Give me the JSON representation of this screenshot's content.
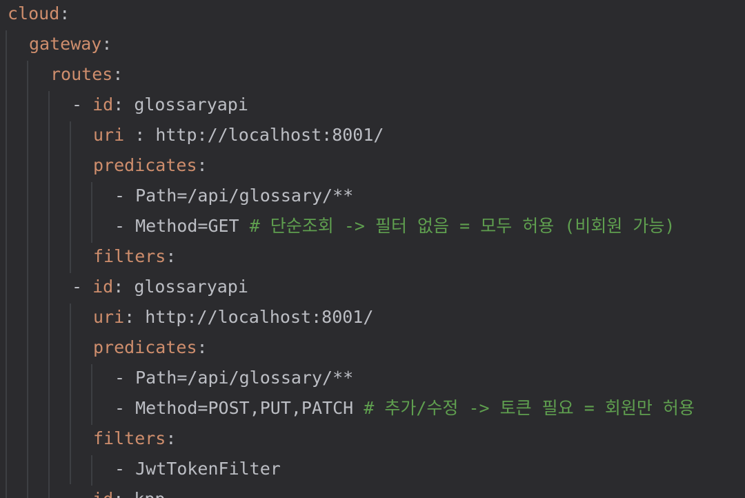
{
  "lines": [
    {
      "indent": 0,
      "key": "cloud",
      "sep": ":",
      "value": "",
      "comment": ""
    },
    {
      "indent": 1,
      "key": "gateway",
      "sep": ":",
      "value": "",
      "comment": ""
    },
    {
      "indent": 2,
      "key": "routes",
      "sep": ":",
      "value": "",
      "comment": ""
    },
    {
      "indent": 3,
      "dash": "- ",
      "key": "id",
      "sep": ":",
      "value": " glossaryapi",
      "comment": ""
    },
    {
      "indent": 4,
      "key": "uri",
      "sep": " :",
      "value": " http://localhost:8001/",
      "comment": ""
    },
    {
      "indent": 4,
      "key": "predicates",
      "sep": ":",
      "value": "",
      "comment": ""
    },
    {
      "indent": 5,
      "dash": "- ",
      "key": "",
      "sep": "",
      "value": "Path=/api/glossary/**",
      "comment": ""
    },
    {
      "indent": 5,
      "dash": "- ",
      "key": "",
      "sep": "",
      "value": "Method=GET ",
      "comment": "# 단순조회 -> 필터 없음 = 모두 허용 (비회원 가능)"
    },
    {
      "indent": 4,
      "key": "filters",
      "sep": ":",
      "value": "",
      "comment": ""
    },
    {
      "indent": 3,
      "dash": "- ",
      "key": "id",
      "sep": ":",
      "value": " glossaryapi",
      "comment": ""
    },
    {
      "indent": 4,
      "key": "uri",
      "sep": ":",
      "value": " http://localhost:8001/",
      "comment": ""
    },
    {
      "indent": 4,
      "key": "predicates",
      "sep": ":",
      "value": "",
      "comment": ""
    },
    {
      "indent": 5,
      "dash": "- ",
      "key": "",
      "sep": "",
      "value": "Path=/api/glossary/**",
      "comment": ""
    },
    {
      "indent": 5,
      "dash": "- ",
      "key": "",
      "sep": "",
      "value": "Method=POST,PUT,PATCH ",
      "comment": "# 추가/수정 -> 토큰 필요 = 회원만 허용"
    },
    {
      "indent": 4,
      "key": "filters",
      "sep": ":",
      "value": "",
      "comment": ""
    },
    {
      "indent": 5,
      "dash": "- ",
      "key": "",
      "sep": "",
      "value": "JwtTokenFilter",
      "comment": ""
    },
    {
      "indent": 3,
      "dash": "- ",
      "key": "id",
      "sep": ":",
      "value": " kpp",
      "comment": ""
    }
  ],
  "colors": {
    "background": "#2b2b2e",
    "key": "#cf8e6d",
    "text": "#bcbec4",
    "comment": "#5f9f4f",
    "indent_guide": "#3d3f43"
  }
}
